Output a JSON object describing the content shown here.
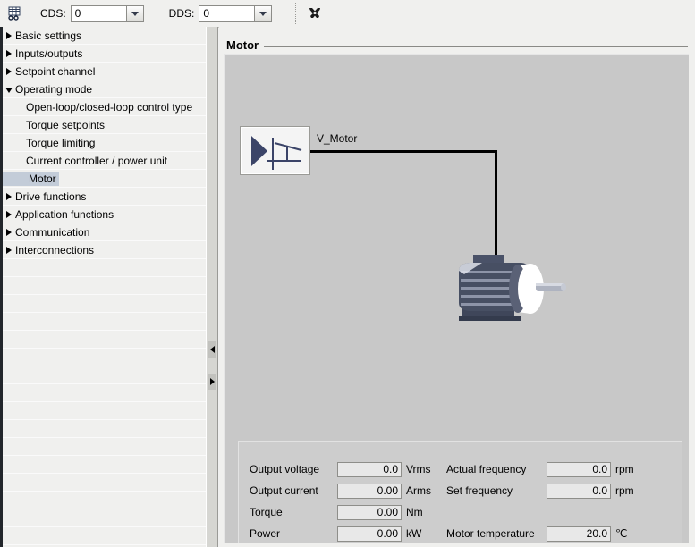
{
  "toolbar": {
    "grid_icon": "table-grid-icon",
    "tools_icon": "hammer-wrench-icon",
    "cds": {
      "label": "CDS:",
      "value": "0"
    },
    "dds": {
      "label": "DDS:",
      "value": "0"
    }
  },
  "sidebar": {
    "items": [
      {
        "label": "Basic settings",
        "level": 0,
        "state": "collapsed",
        "selected": false
      },
      {
        "label": "Inputs/outputs",
        "level": 0,
        "state": "collapsed",
        "selected": false
      },
      {
        "label": "Setpoint channel",
        "level": 0,
        "state": "collapsed",
        "selected": false
      },
      {
        "label": "Operating mode",
        "level": 0,
        "state": "expanded",
        "selected": false
      },
      {
        "label": "Open-loop/closed-loop control type",
        "level": 1,
        "state": "leaf",
        "selected": false
      },
      {
        "label": "Torque setpoints",
        "level": 1,
        "state": "leaf",
        "selected": false
      },
      {
        "label": "Torque limiting",
        "level": 1,
        "state": "leaf",
        "selected": false
      },
      {
        "label": "Current controller / power unit",
        "level": 1,
        "state": "leaf",
        "selected": false
      },
      {
        "label": "Motor",
        "level": 1,
        "state": "leaf",
        "selected": true
      },
      {
        "label": "Drive functions",
        "level": 0,
        "state": "collapsed",
        "selected": false
      },
      {
        "label": "Application functions",
        "level": 0,
        "state": "collapsed",
        "selected": false
      },
      {
        "label": "Communication",
        "level": 0,
        "state": "collapsed",
        "selected": false
      },
      {
        "label": "Interconnections",
        "level": 0,
        "state": "collapsed",
        "selected": false
      }
    ]
  },
  "main": {
    "title": "Motor",
    "diagram": {
      "block_icon": "voltage-ramp-icon",
      "block_label": "V_Motor",
      "motor_icon": "electric-motor-icon"
    },
    "values": {
      "left": [
        {
          "label": "Output voltage",
          "value": "0.0",
          "unit": "Vrms"
        },
        {
          "label": "Output current",
          "value": "0.00",
          "unit": "Arms"
        },
        {
          "label": "Torque",
          "value": "0.00",
          "unit": "Nm"
        },
        {
          "label": "Power",
          "value": "0.00",
          "unit": "kW"
        }
      ],
      "right": [
        {
          "label": "Actual frequency",
          "value": "0.0",
          "unit": "rpm"
        },
        {
          "label": "Set frequency",
          "value": "0.0",
          "unit": "rpm"
        },
        {
          "label": "Motor temperature",
          "value": "20.0",
          "unit": "℃"
        }
      ]
    }
  },
  "colors": {
    "motor_body": "#474f63",
    "motor_body_dark": "#3a4154",
    "motor_fin": "#8d94a8",
    "motor_endbell": "#ffffff",
    "shaft": "#aeb3c0",
    "selection": "#c3ccd8",
    "panel": "#c8c8c8"
  }
}
